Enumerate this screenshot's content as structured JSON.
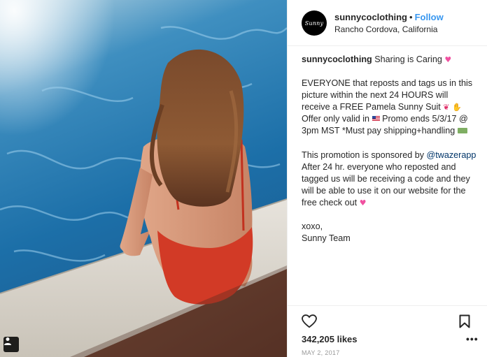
{
  "photo": {
    "alt": ""
  },
  "header": {
    "avatar_text": "Sunny",
    "username": "sunnycoclothing",
    "separator": "•",
    "follow_label": "Follow",
    "location": "Rancho Cordova, California"
  },
  "caption": {
    "username": "sunnycoclothing",
    "p1_text": "Sharing is Caring",
    "p2_line1": "EVERYONE that reposts and tags us in this",
    "p2_line2": "picture within the next 24 HOURS will",
    "p2_line3": "receive a FREE Pamela Sunny Suit",
    "p2_line4": "Offer only valid in",
    "p2_line4b": "Promo ends 5/3/17 @",
    "p2_line5": "3pm MST *Must pay shipping+handling",
    "p3_line1": "This promotion is sponsored by",
    "p3_mention": "@twazerapp",
    "p3_line2": "After 24 hr. everyone who reposted and",
    "p3_line3": "tagged us will be receiving a code and they",
    "p3_line4": "will be able to use it on our website for the",
    "p3_line5": "free check out",
    "p4_line1": "xoxo,",
    "p4_line2": "Sunny Team"
  },
  "actions": {
    "likes": "342,205 likes",
    "date": "MAY 2, 2017",
    "more_label": "•••"
  },
  "colors": {
    "link_blue": "#3897f0",
    "mention_blue": "#003569",
    "text": "#262626",
    "muted": "#999999"
  },
  "icons": [
    "heart-icon",
    "bookmark-icon",
    "more-options-icon",
    "tagged-user-icon",
    "flag-us-emoji",
    "bikini-emoji",
    "clap-emoji",
    "heart-emoji",
    "money-emoji"
  ]
}
